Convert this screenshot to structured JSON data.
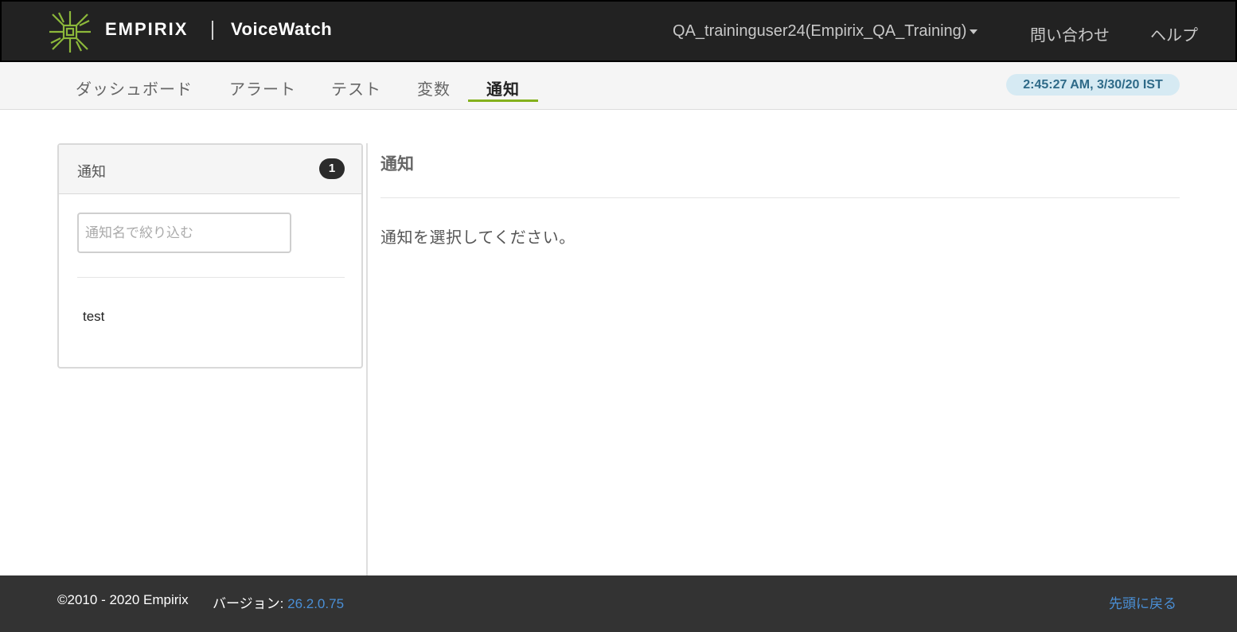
{
  "header": {
    "brand": "EMPIRIX",
    "product": "VoiceWatch",
    "user_menu": "QA_traininguser24(Empirix_QA_Training)",
    "contact": "問い合わせ",
    "help": "ヘルプ"
  },
  "nav": {
    "tabs": [
      {
        "label": "ダッシュボード"
      },
      {
        "label": "アラート"
      },
      {
        "label": "テスト"
      },
      {
        "label": "変数"
      },
      {
        "label": "通知",
        "active": true
      }
    ],
    "clock": "2:45:27 AM, 3/30/20 IST"
  },
  "sidebar": {
    "title": "通知",
    "count": "1",
    "filter_placeholder": "通知名で絞り込む",
    "items": [
      {
        "label": "test"
      }
    ]
  },
  "main": {
    "title": "通知",
    "message": "通知を選択してください。"
  },
  "footer": {
    "copyright": "©2010 - 2020 Empirix",
    "version_label": "バージョン:",
    "version": "26.2.0.75",
    "back_to_top": "先頭に戻る"
  },
  "colors": {
    "header_bg": "#222222",
    "logo_green": "#8cb83a",
    "tab_underline": "#84b11c",
    "clock_bg": "#d6eaf3",
    "clock_text": "#2e6a88",
    "footer_bg": "#333333",
    "link": "#4a8fd6"
  }
}
